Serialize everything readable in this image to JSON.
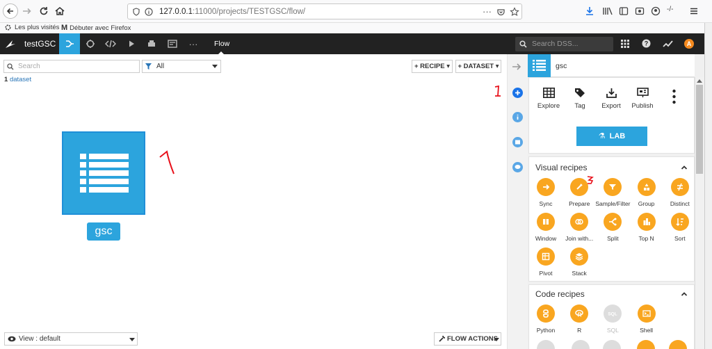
{
  "browser": {
    "url_host": "127.0.0.1",
    "url_rest": ":11000/projects/TESTGSC/flow/",
    "bookmarks": [
      {
        "label": "Les plus visités"
      },
      {
        "label": "Débuter avec Firefox"
      }
    ]
  },
  "nav": {
    "project": "testGSC",
    "flow_label": "Flow",
    "search_placeholder": "Search DSS...",
    "avatar": "A",
    "more": "···"
  },
  "flow": {
    "search_placeholder": "Search",
    "filter_value": "All",
    "recipe_btn": "+ RECIPE",
    "dataset_btn": "+ DATASET",
    "count_number": "1",
    "count_label": "dataset",
    "dataset_name": "gsc",
    "view_select": "View : default",
    "flow_actions": "FLOW ACTIONS"
  },
  "annotations": {
    "mark1": "1",
    "mark2": "2",
    "mark3": "3",
    "color": "#e8101a"
  },
  "panel": {
    "title": "gsc",
    "actions": [
      {
        "label": "Explore",
        "icon": "table-icon"
      },
      {
        "label": "Tag",
        "icon": "tag-icon"
      },
      {
        "label": "Export",
        "icon": "export-icon"
      },
      {
        "label": "Publish",
        "icon": "publish-icon"
      }
    ],
    "lab_label": "LAB",
    "visual_title": "Visual recipes",
    "visual": [
      {
        "label": "Sync",
        "icon": "sync-icon"
      },
      {
        "label": "Prepare",
        "icon": "brush-icon"
      },
      {
        "label": "Sample/Filter",
        "icon": "funnel-icon"
      },
      {
        "label": "Group",
        "icon": "group-icon"
      },
      {
        "label": "Distinct",
        "icon": "not-equal-icon"
      },
      {
        "label": "Window",
        "icon": "window-icon"
      },
      {
        "label": "Join with...",
        "icon": "join-icon"
      },
      {
        "label": "Split",
        "icon": "split-icon"
      },
      {
        "label": "Top N",
        "icon": "topn-icon"
      },
      {
        "label": "Sort",
        "icon": "sort-icon"
      },
      {
        "label": "Pivot",
        "icon": "pivot-icon"
      },
      {
        "label": "Stack",
        "icon": "stack-icon"
      }
    ],
    "code_title": "Code recipes",
    "code": [
      {
        "label": "Python",
        "icon": "python-icon",
        "enabled": true
      },
      {
        "label": "R",
        "icon": "r-icon",
        "enabled": true
      },
      {
        "label": "SQL",
        "icon": "sql-icon",
        "enabled": false
      },
      {
        "label": "Shell",
        "icon": "shell-icon",
        "enabled": true
      }
    ]
  },
  "colors": {
    "accent": "#2ca4dd",
    "recipe_orange": "#f9a620",
    "nav_bg": "#222222"
  }
}
